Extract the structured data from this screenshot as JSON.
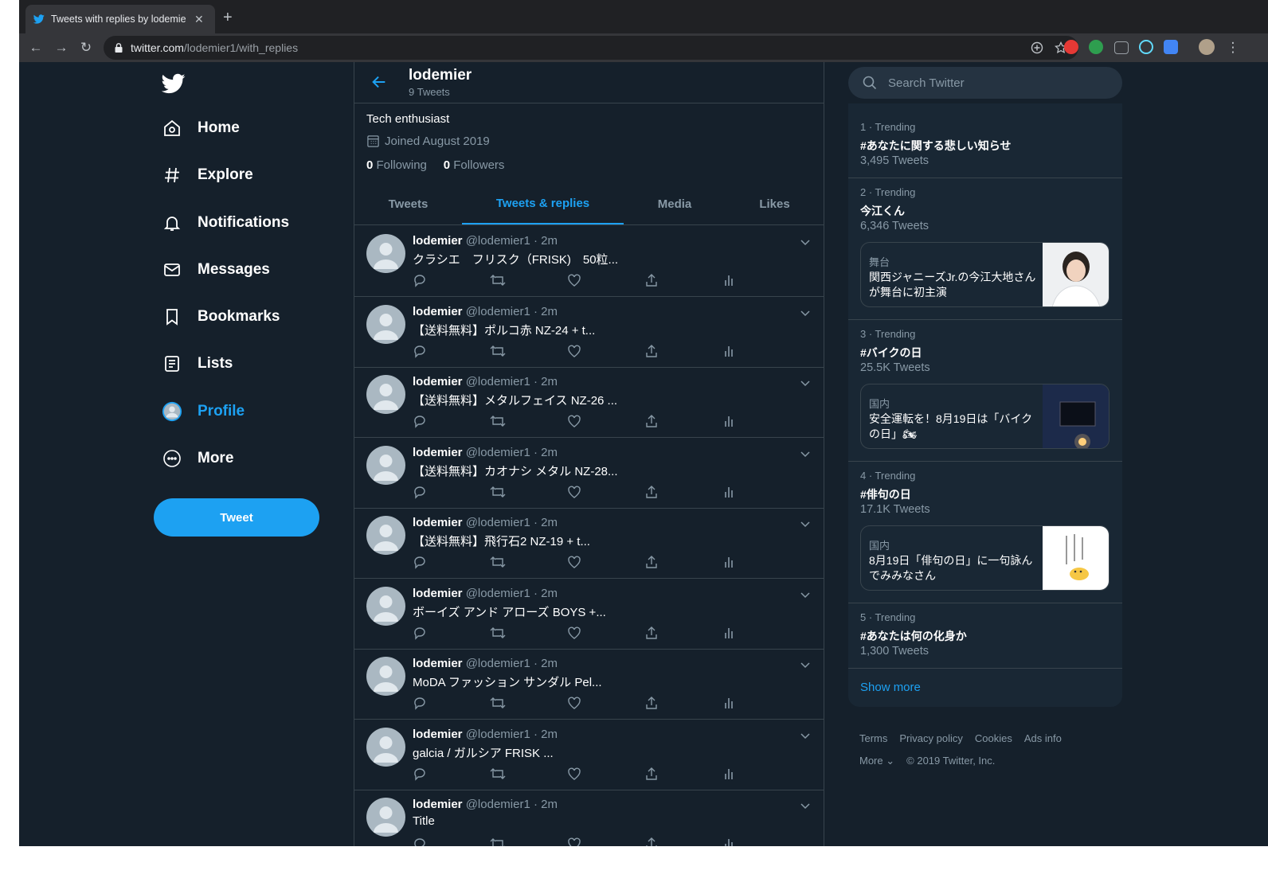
{
  "browser": {
    "tab_title": "Tweets with replies by lodemie",
    "url_host": "twitter.com",
    "url_path": "/lodemier1/with_replies"
  },
  "nav": {
    "items": [
      {
        "label": "Home",
        "icon": "home-icon"
      },
      {
        "label": "Explore",
        "icon": "hashtag-icon"
      },
      {
        "label": "Notifications",
        "icon": "bell-icon"
      },
      {
        "label": "Messages",
        "icon": "envelope-icon"
      },
      {
        "label": "Bookmarks",
        "icon": "bookmark-icon"
      },
      {
        "label": "Lists",
        "icon": "list-icon"
      },
      {
        "label": "Profile",
        "icon": "avatar-icon"
      },
      {
        "label": "More",
        "icon": "more-icon"
      }
    ],
    "tweet_button": "Tweet"
  },
  "profile": {
    "name": "lodemier",
    "tweet_count": "9 Tweets",
    "bio": "Tech enthusiast",
    "joined": "Joined August 2019",
    "following_count": "0",
    "following_label": "Following",
    "followers_count": "0",
    "followers_label": "Followers",
    "tabs": [
      "Tweets",
      "Tweets & replies",
      "Media",
      "Likes"
    ],
    "active_tab": "Tweets & replies"
  },
  "tweets": [
    {
      "name": "lodemier",
      "handle": "@lodemier1 · 2m",
      "text": "クラシエ　フリスク（FRISK)　50粒..."
    },
    {
      "name": "lodemier",
      "handle": "@lodemier1 · 2m",
      "text": "【送料無料】ポルコ赤 NZ-24 + t..."
    },
    {
      "name": "lodemier",
      "handle": "@lodemier1 · 2m",
      "text": "【送料無料】メタルフェイス NZ-26 ..."
    },
    {
      "name": "lodemier",
      "handle": "@lodemier1 · 2m",
      "text": "【送料無料】カオナシ メタル NZ-28..."
    },
    {
      "name": "lodemier",
      "handle": "@lodemier1 · 2m",
      "text": "【送料無料】飛行石2 NZ-19 + t..."
    },
    {
      "name": "lodemier",
      "handle": "@lodemier1 · 2m",
      "text": "ボーイズ アンド アローズ BOYS +..."
    },
    {
      "name": "lodemier",
      "handle": "@lodemier1 · 2m",
      "text": "MoDA ファッション サンダル Pel..."
    },
    {
      "name": "lodemier",
      "handle": "@lodemier1 · 2m",
      "text": "galcia / ガルシア FRISK ..."
    },
    {
      "name": "lodemier",
      "handle": "@lodemier1 · 2m",
      "text": "Title"
    }
  ],
  "search": {
    "placeholder": "Search Twitter"
  },
  "trends": [
    {
      "meta": "1 · Trending",
      "name": "#あなたに関する悲しい知らせ",
      "count": "3,495 Tweets"
    },
    {
      "meta": "2 · Trending",
      "name": "今江くん",
      "count": "6,346 Tweets",
      "card": {
        "category": "舞台",
        "text": "関西ジャニーズJr.の今江大地さんが舞台に初主演"
      }
    },
    {
      "meta": "3 · Trending",
      "name": "#バイクの日",
      "count": "25.5K Tweets",
      "card": {
        "category": "国内",
        "text": "安全運転を！8月19日は「バイクの日」🏍"
      }
    },
    {
      "meta": "4 · Trending",
      "name": "#俳句の日",
      "count": "17.1K Tweets",
      "card": {
        "category": "国内",
        "text": "8月19日「俳句の日」に一句詠んでみみなさん"
      }
    },
    {
      "meta": "5 · Trending",
      "name": "#あなたは何の化身か",
      "count": "1,300 Tweets"
    }
  ],
  "show_more": "Show more",
  "footer": {
    "links": [
      "Terms",
      "Privacy policy",
      "Cookies",
      "Ads info"
    ],
    "more": "More",
    "copyright": "© 2019 Twitter, Inc."
  },
  "colors": {
    "background": "#15202b",
    "accent": "#1da1f2",
    "secondary_text": "#8899a6",
    "border": "#38444d"
  }
}
